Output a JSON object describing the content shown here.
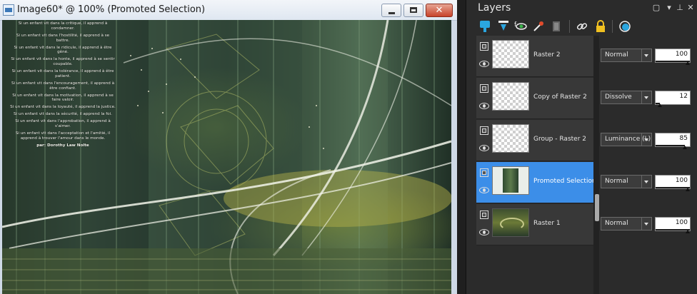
{
  "image_window": {
    "title": "Image60* @ 100% (Promoted Selection)",
    "close_glyph": "✕",
    "poem": [
      "Si un enfant vit dans la critique, il apprend à condamner.",
      "Si un enfant vit dans l'hostilité, il apprend à se battre.",
      "Si un enfant vit dans le ridicule, il apprend à être gêné.",
      "Si un enfant vit dans la honte, il apprend à se sentir coupable.",
      "Si un enfant vit dans la tolérance, il apprend à être patient.",
      "Si un enfant vit dans l'encouragement, il apprend à être confiant.",
      "Si un enfant vit dans la motivation, il apprend à se faire valoir.",
      "Si un enfant vit dans la loyauté, il apprend la justice.",
      "Si un enfant vit dans la sécurité, il apprend la foi.",
      "Si un enfant vit dans l'approbation, il apprend à s'aimer.",
      "Si un enfant vit dans l'acceptation et l'amitié, il apprend à trouver l'amour dans le monde."
    ],
    "signature": "par: Dorothy Law Nolte"
  },
  "layers_palette": {
    "title": "Layers",
    "layers": [
      {
        "name": "Raster 2",
        "blend_mode": "Normal",
        "opacity": 100,
        "selected": false,
        "thumbnail": "transparent"
      },
      {
        "name": "Copy of Raster 2",
        "blend_mode": "Dissolve",
        "opacity": 12,
        "selected": false,
        "thumbnail": "transparent"
      },
      {
        "name": "Group - Raster 2",
        "blend_mode": "Luminance (L)",
        "opacity": 85,
        "selected": false,
        "thumbnail": "transparent"
      },
      {
        "name": "Promoted Selection",
        "blend_mode": "Normal",
        "opacity": 100,
        "selected": true,
        "thumbnail": "image"
      },
      {
        "name": "Raster 1",
        "blend_mode": "Normal",
        "opacity": 100,
        "selected": false,
        "thumbnail": "image"
      }
    ],
    "toolbar_icons": [
      "new-raster-layer-icon",
      "new-vector-layer-icon",
      "new-mask-layer-icon",
      "new-adjustment-layer-icon",
      "delete-layer-icon",
      "link-layers-icon",
      "lock-transparency-icon",
      "edit-selection-icon"
    ],
    "colors": {
      "selected_row": "#3c8ee8",
      "panel_bg": "#2b2b2b",
      "row_bg": "#383838",
      "toolbar_accent": "#2aa6e0"
    }
  }
}
